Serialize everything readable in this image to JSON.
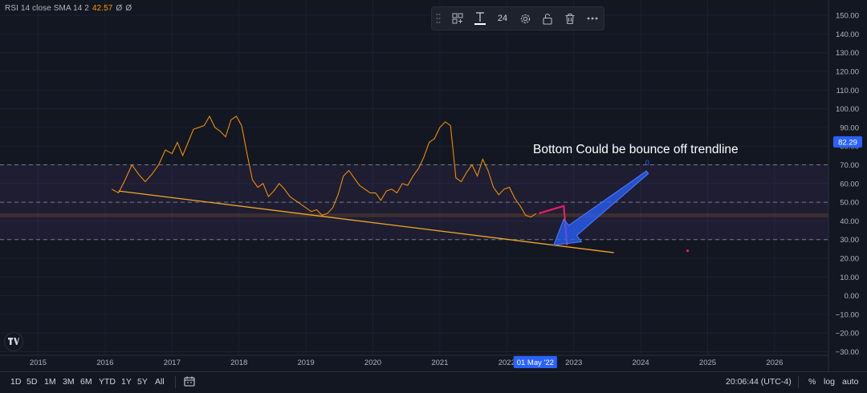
{
  "legend": {
    "name": "RSI 14 close SMA 14 2",
    "value": "42.57",
    "nan1": "Ø",
    "nan2": "Ø"
  },
  "toolbar": {
    "font_size": "24"
  },
  "annotation": {
    "text": "Bottom Could be bounce off trendline",
    "marker": "0"
  },
  "colors": {
    "background": "#131722",
    "rsi_line": "#ff9800",
    "trendline": "#f5a623",
    "pink": "#e91e63",
    "arrow": "#2962ff",
    "band": "#7e57c2",
    "price_label": "#2962ff"
  },
  "chart_data": {
    "type": "line",
    "ylim": [
      -35,
      155
    ],
    "xlim": [
      2014.6,
      2026.9
    ],
    "y_ticks": [
      "150.00",
      "140.00",
      "130.00",
      "120.00",
      "110.00",
      "100.00",
      "90.00",
      "80.00",
      "70.00",
      "60.00",
      "50.00",
      "40.00",
      "30.00",
      "20.00",
      "10.00",
      "0.00",
      "−10.00",
      "−20.00",
      "−30.00"
    ],
    "y_tick_values": [
      150,
      140,
      130,
      120,
      110,
      100,
      90,
      80,
      70,
      60,
      50,
      40,
      30,
      20,
      10,
      0,
      -10,
      -20,
      -30
    ],
    "x_ticks": [
      "2015",
      "2016",
      "2017",
      "2018",
      "2019",
      "2020",
      "2021",
      "2022",
      "2023",
      "2024",
      "2025",
      "2026"
    ],
    "x_tick_values": [
      2015,
      2016,
      2017,
      2018,
      2019,
      2020,
      2021,
      2022,
      2023,
      2024,
      2025,
      2026
    ],
    "levels": [
      70,
      50,
      30
    ],
    "band": [
      30,
      70
    ],
    "highlight_band": [
      42,
      44
    ],
    "current_value_label": "82.29",
    "current_value": 82.29,
    "crosshair_x_label": "01 May '22",
    "crosshair_x": 2022.33,
    "series": [
      {
        "x": [
          2016.1,
          2016.2,
          2016.3,
          2016.4,
          2016.5,
          2016.6,
          2016.7,
          2016.8,
          2016.9,
          2017.0,
          2017.08,
          2017.16,
          2017.24,
          2017.32,
          2017.4,
          2017.48,
          2017.56,
          2017.64,
          2017.72,
          2017.8,
          2017.88,
          2017.96,
          2018.04,
          2018.12,
          2018.2,
          2018.28,
          2018.36,
          2018.44,
          2018.52,
          2018.6,
          2018.68,
          2018.76,
          2018.84,
          2018.92,
          2019.0,
          2019.08,
          2019.16,
          2019.24,
          2019.32,
          2019.4,
          2019.48,
          2019.56,
          2019.64,
          2019.72,
          2019.8,
          2019.88,
          2019.96,
          2020.04,
          2020.12,
          2020.2,
          2020.28,
          2020.36,
          2020.44,
          2020.52,
          2020.6,
          2020.68,
          2020.76,
          2020.84,
          2020.92,
          2021.0,
          2021.08,
          2021.16,
          2021.24,
          2021.32,
          2021.4,
          2021.48,
          2021.56,
          2021.64,
          2021.72,
          2021.8,
          2021.88,
          2021.96,
          2022.04,
          2022.12,
          2022.2,
          2022.28,
          2022.36,
          2022.44
        ],
        "values": [
          57,
          55,
          62,
          70,
          65,
          61,
          65,
          70,
          78,
          76,
          82,
          75,
          82,
          89,
          90,
          91,
          96,
          90,
          88,
          85,
          94,
          96,
          91,
          76,
          62,
          58,
          60,
          53,
          56,
          60,
          57,
          53,
          51,
          49,
          47,
          45,
          46,
          43,
          44,
          47,
          54,
          64,
          67,
          63,
          59,
          57,
          55,
          55,
          51,
          56,
          57,
          55,
          60,
          59,
          64,
          68,
          74,
          82,
          84,
          90,
          93,
          91,
          63,
          61,
          66,
          70,
          64,
          73,
          67,
          58,
          54,
          57,
          58,
          52,
          48,
          43,
          42,
          44
        ]
      },
      {
        "x": [
          2022.48,
          2022.85,
          2022.9
        ],
        "values": [
          44,
          48,
          27
        ]
      }
    ],
    "trendline": {
      "x": [
        2016.2,
        2023.6
      ],
      "values": [
        56,
        23
      ]
    },
    "arrow": {
      "from": [
        2024.1,
        66
      ],
      "to": [
        2022.7,
        27
      ]
    },
    "dot": {
      "x": 2024.7,
      "value": 24
    },
    "marker": {
      "x": 2024.1,
      "value": 71
    }
  },
  "bottom": {
    "ranges": [
      "1D",
      "5D",
      "1M",
      "3M",
      "6M",
      "YTD",
      "1Y",
      "5Y",
      "All"
    ],
    "time": "20:06:44 (UTC-4)",
    "percent": "%",
    "log": "log",
    "auto": "auto"
  }
}
